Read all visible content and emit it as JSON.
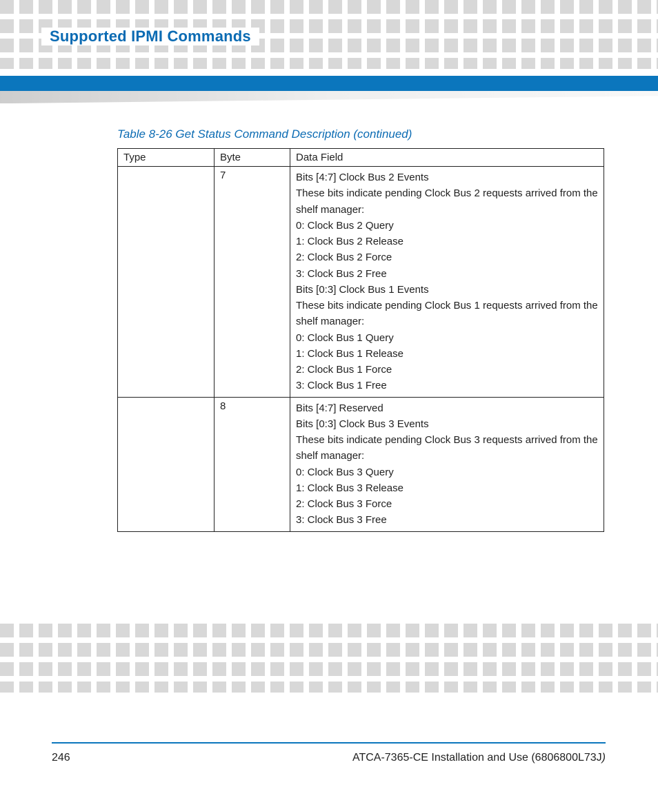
{
  "header": {
    "title": "Supported IPMI Commands"
  },
  "table": {
    "caption": "Table 8-26 Get Status Command Description (continued)",
    "columns": {
      "c1": "Type",
      "c2": "Byte",
      "c3": "Data Field"
    },
    "rows": [
      {
        "type": "",
        "byte": "7",
        "data_lines": [
          "Bits [4:7] Clock Bus 2 Events",
          "These bits indicate pending Clock Bus 2 requests arrived from the shelf manager:",
          "0: Clock Bus 2 Query",
          "1: Clock Bus 2 Release",
          "2: Clock Bus 2 Force",
          "3: Clock Bus 2 Free",
          "Bits [0:3] Clock Bus 1 Events",
          "These bits indicate pending Clock Bus 1 requests arrived from the shelf manager:",
          "0: Clock Bus 1 Query",
          "1: Clock Bus 1 Release",
          "2: Clock Bus 1 Force",
          "3: Clock Bus 1 Free"
        ]
      },
      {
        "type": "",
        "byte": "8",
        "data_lines": [
          "Bits [4:7] Reserved",
          "Bits [0:3] Clock Bus 3 Events",
          "These bits indicate pending Clock Bus 3 requests arrived from the shelf manager:",
          "0: Clock Bus 3 Query",
          "1: Clock Bus 3 Release",
          "2: Clock Bus 3 Force",
          "3: Clock Bus 3 Free"
        ]
      }
    ]
  },
  "footer": {
    "page_number": "246",
    "doc_title_prefix": "ATCA-7365-CE Installation and Use (6806800L73J",
    "doc_title_suffix": ")"
  }
}
